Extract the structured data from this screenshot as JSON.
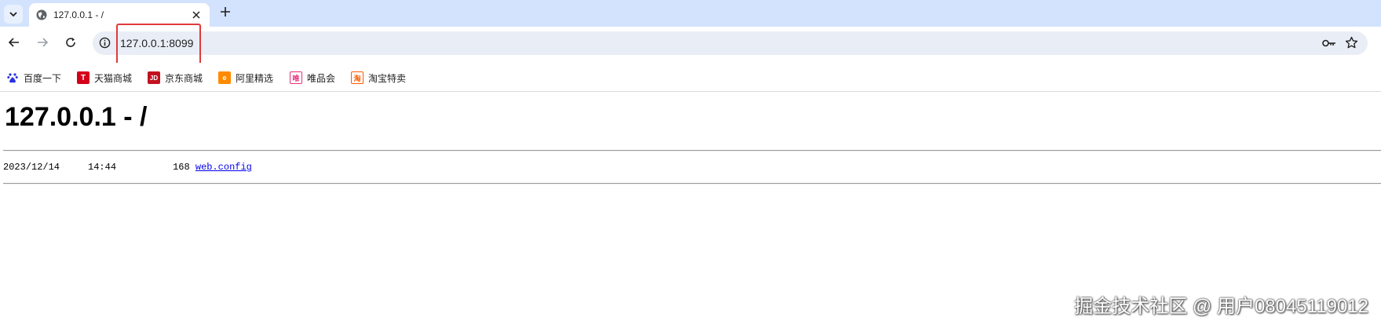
{
  "tab": {
    "title": "127.0.0.1 - /"
  },
  "toolbar": {
    "url": "127.0.0.1:8099"
  },
  "bookmarks": [
    {
      "label": "百度一下",
      "icon": "baidu-paw-icon",
      "color": "#2932e1"
    },
    {
      "label": "天猫商城",
      "icon": "tmall-icon",
      "color": "#d4001a"
    },
    {
      "label": "京东商城",
      "icon": "jd-icon",
      "color": "#c1121f"
    },
    {
      "label": "阿里精选",
      "icon": "ali-icon",
      "color": "#ff8a00"
    },
    {
      "label": "唯品会",
      "icon": "vip-icon",
      "color": "#e6307a"
    },
    {
      "label": "淘宝特卖",
      "icon": "taobao-icon",
      "color": "#ff5a00"
    }
  ],
  "page": {
    "heading": "127.0.0.1 - /",
    "files": [
      {
        "date": "2023/12/14",
        "time": "14:44",
        "size": "168",
        "name": "web.config"
      }
    ]
  },
  "watermark": "掘金技术社区 @ 用户08045119012"
}
